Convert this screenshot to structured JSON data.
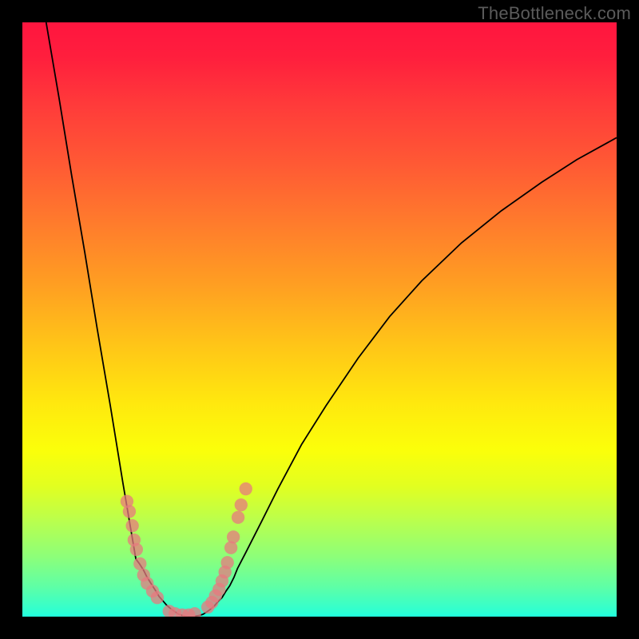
{
  "watermark": "TheBottleneck.com",
  "colors": {
    "background": "#000000",
    "dot": "#e77a7f",
    "curve": "#000000"
  },
  "chart_data": {
    "type": "line",
    "title": "",
    "xlabel": "",
    "ylabel": "",
    "xlim": [
      0,
      100
    ],
    "ylim": [
      0,
      100
    ],
    "note": "Axes are unlabeled in the image; values below are estimated screen-space coordinates (x,y in percent of plot width/height, y increasing downward) read from the rendered curve and marker positions.",
    "series": [
      {
        "name": "curve-left-branch",
        "x": [
          4.0,
          6.2,
          8.3,
          10.5,
          12.6,
          14.8,
          16.9,
          19.1,
          19.7,
          20.4,
          21.0,
          21.7,
          22.4,
          23.0,
          23.7,
          24.3,
          25.0,
          25.7,
          26.3
        ],
        "y": [
          0.0,
          12.9,
          25.8,
          38.7,
          51.6,
          64.5,
          77.4,
          90.3,
          91.1,
          92.2,
          93.4,
          94.5,
          95.6,
          96.6,
          97.4,
          98.1,
          98.7,
          99.2,
          99.6
        ]
      },
      {
        "name": "curve-bottom",
        "x": [
          26.3,
          26.9,
          27.4,
          28.0,
          28.6,
          29.2,
          29.8,
          30.4
        ],
        "y": [
          99.6,
          99.8,
          99.9,
          100.0,
          100.0,
          99.9,
          99.8,
          99.6
        ]
      },
      {
        "name": "curve-right-branch",
        "x": [
          30.9,
          31.6,
          32.3,
          32.9,
          33.6,
          34.2,
          34.9,
          35.6,
          36.2,
          37.6,
          40.3,
          43.0,
          47.0,
          51.1,
          56.5,
          61.8,
          67.2,
          73.9,
          80.6,
          87.4,
          93.3,
          100.0
        ],
        "y": [
          99.3,
          98.8,
          98.2,
          97.5,
          96.8,
          95.8,
          94.8,
          93.4,
          91.9,
          89.2,
          83.9,
          78.5,
          71.0,
          64.5,
          56.5,
          49.5,
          43.5,
          37.1,
          31.7,
          26.9,
          23.1,
          19.4
        ]
      }
    ],
    "markers_left": [
      {
        "x": 17.6,
        "y": 80.6
      },
      {
        "x": 18.0,
        "y": 82.3
      },
      {
        "x": 18.5,
        "y": 84.7
      },
      {
        "x": 18.8,
        "y": 87.1
      },
      {
        "x": 19.2,
        "y": 88.7
      },
      {
        "x": 19.8,
        "y": 91.1
      },
      {
        "x": 20.4,
        "y": 93.0
      },
      {
        "x": 21.0,
        "y": 94.4
      },
      {
        "x": 21.9,
        "y": 95.7
      },
      {
        "x": 22.7,
        "y": 96.8
      }
    ],
    "markers_bottom": [
      {
        "x": 24.7,
        "y": 99.1
      },
      {
        "x": 25.7,
        "y": 99.5
      },
      {
        "x": 26.9,
        "y": 99.7
      },
      {
        "x": 28.0,
        "y": 99.7
      },
      {
        "x": 29.0,
        "y": 99.5
      }
    ],
    "markers_right": [
      {
        "x": 31.2,
        "y": 98.4
      },
      {
        "x": 31.9,
        "y": 97.6
      },
      {
        "x": 32.5,
        "y": 96.5
      },
      {
        "x": 33.1,
        "y": 95.4
      },
      {
        "x": 33.6,
        "y": 94.0
      },
      {
        "x": 34.1,
        "y": 92.5
      },
      {
        "x": 34.5,
        "y": 90.9
      },
      {
        "x": 35.1,
        "y": 88.4
      },
      {
        "x": 35.5,
        "y": 86.6
      },
      {
        "x": 36.3,
        "y": 83.3
      },
      {
        "x": 36.8,
        "y": 81.2
      },
      {
        "x": 37.6,
        "y": 78.5
      }
    ],
    "marker_radius_percent": 1.1
  }
}
